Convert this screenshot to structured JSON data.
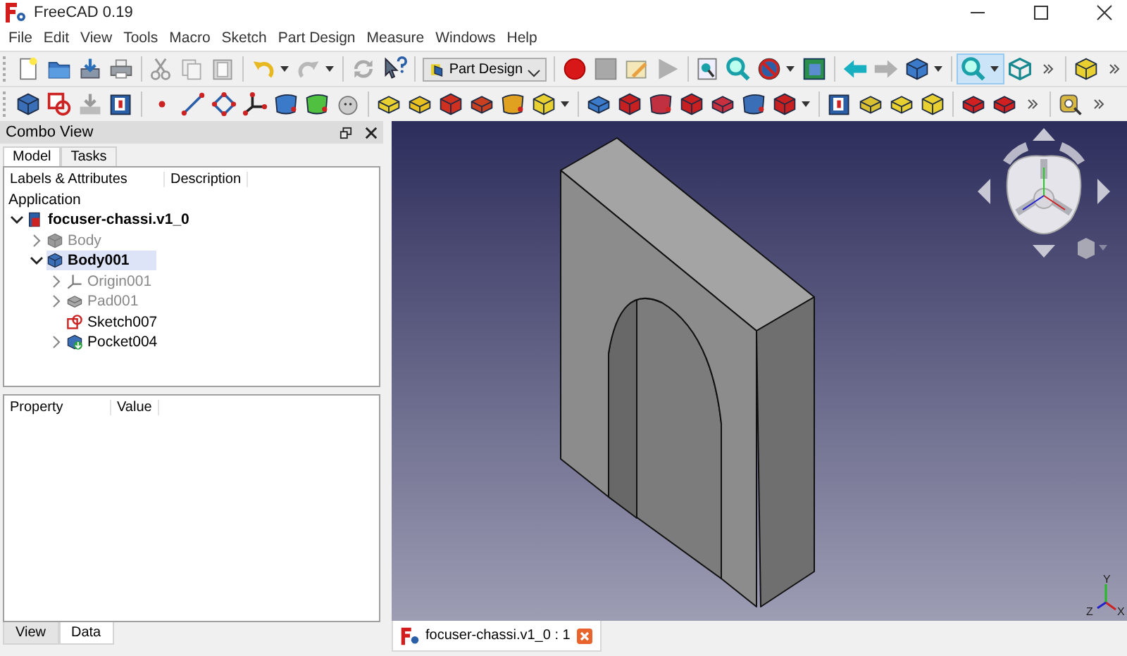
{
  "window": {
    "title": "FreeCAD 0.19"
  },
  "menu": [
    "File",
    "Edit",
    "View",
    "Tools",
    "Macro",
    "Sketch",
    "Part Design",
    "Measure",
    "Windows",
    "Help"
  ],
  "toolbar": {
    "workbench": "Part Design",
    "box_zoom_pressed": true
  },
  "combo_view": {
    "title": "Combo View",
    "tabs": [
      {
        "label": "Model",
        "selected": true
      },
      {
        "label": "Tasks",
        "selected": false
      }
    ],
    "tree": {
      "columns": [
        "Labels & Attributes",
        "Description"
      ],
      "root_label": "Application",
      "items": [
        {
          "label": "focuser-chassi.v1_0",
          "kind": "document",
          "expandable": true,
          "expanded": true,
          "visible": true,
          "active": true,
          "selected": false,
          "children": [
            {
              "label": "Body",
              "kind": "body",
              "expandable": true,
              "expanded": false,
              "visible": false,
              "active": false,
              "selected": false
            },
            {
              "label": "Body001",
              "kind": "body",
              "expandable": true,
              "expanded": true,
              "visible": true,
              "active": true,
              "selected": true,
              "children": [
                {
                  "label": "Origin001",
                  "kind": "origin",
                  "expandable": true,
                  "expanded": false,
                  "visible": false,
                  "active": false,
                  "selected": false
                },
                {
                  "label": "Pad001",
                  "kind": "pad",
                  "expandable": true,
                  "expanded": false,
                  "visible": false,
                  "active": false,
                  "selected": false
                },
                {
                  "label": "Sketch007",
                  "kind": "sketch",
                  "expandable": false,
                  "visible": true,
                  "active": false,
                  "selected": false
                },
                {
                  "label": "Pocket004",
                  "kind": "pocket",
                  "expandable": true,
                  "expanded": false,
                  "visible": true,
                  "active": false,
                  "selected": false
                }
              ]
            }
          ]
        }
      ]
    }
  },
  "property_view": {
    "columns": [
      "Property",
      "Value"
    ],
    "tabs": [
      {
        "label": "View",
        "selected": false
      },
      {
        "label": "Data",
        "selected": true
      }
    ]
  },
  "viewport": {
    "axis_labels": [
      "Y",
      "Z",
      "X"
    ]
  },
  "document_tabs": [
    {
      "label": "focuser-chassi.v1_0 : 1",
      "selected": true
    }
  ]
}
